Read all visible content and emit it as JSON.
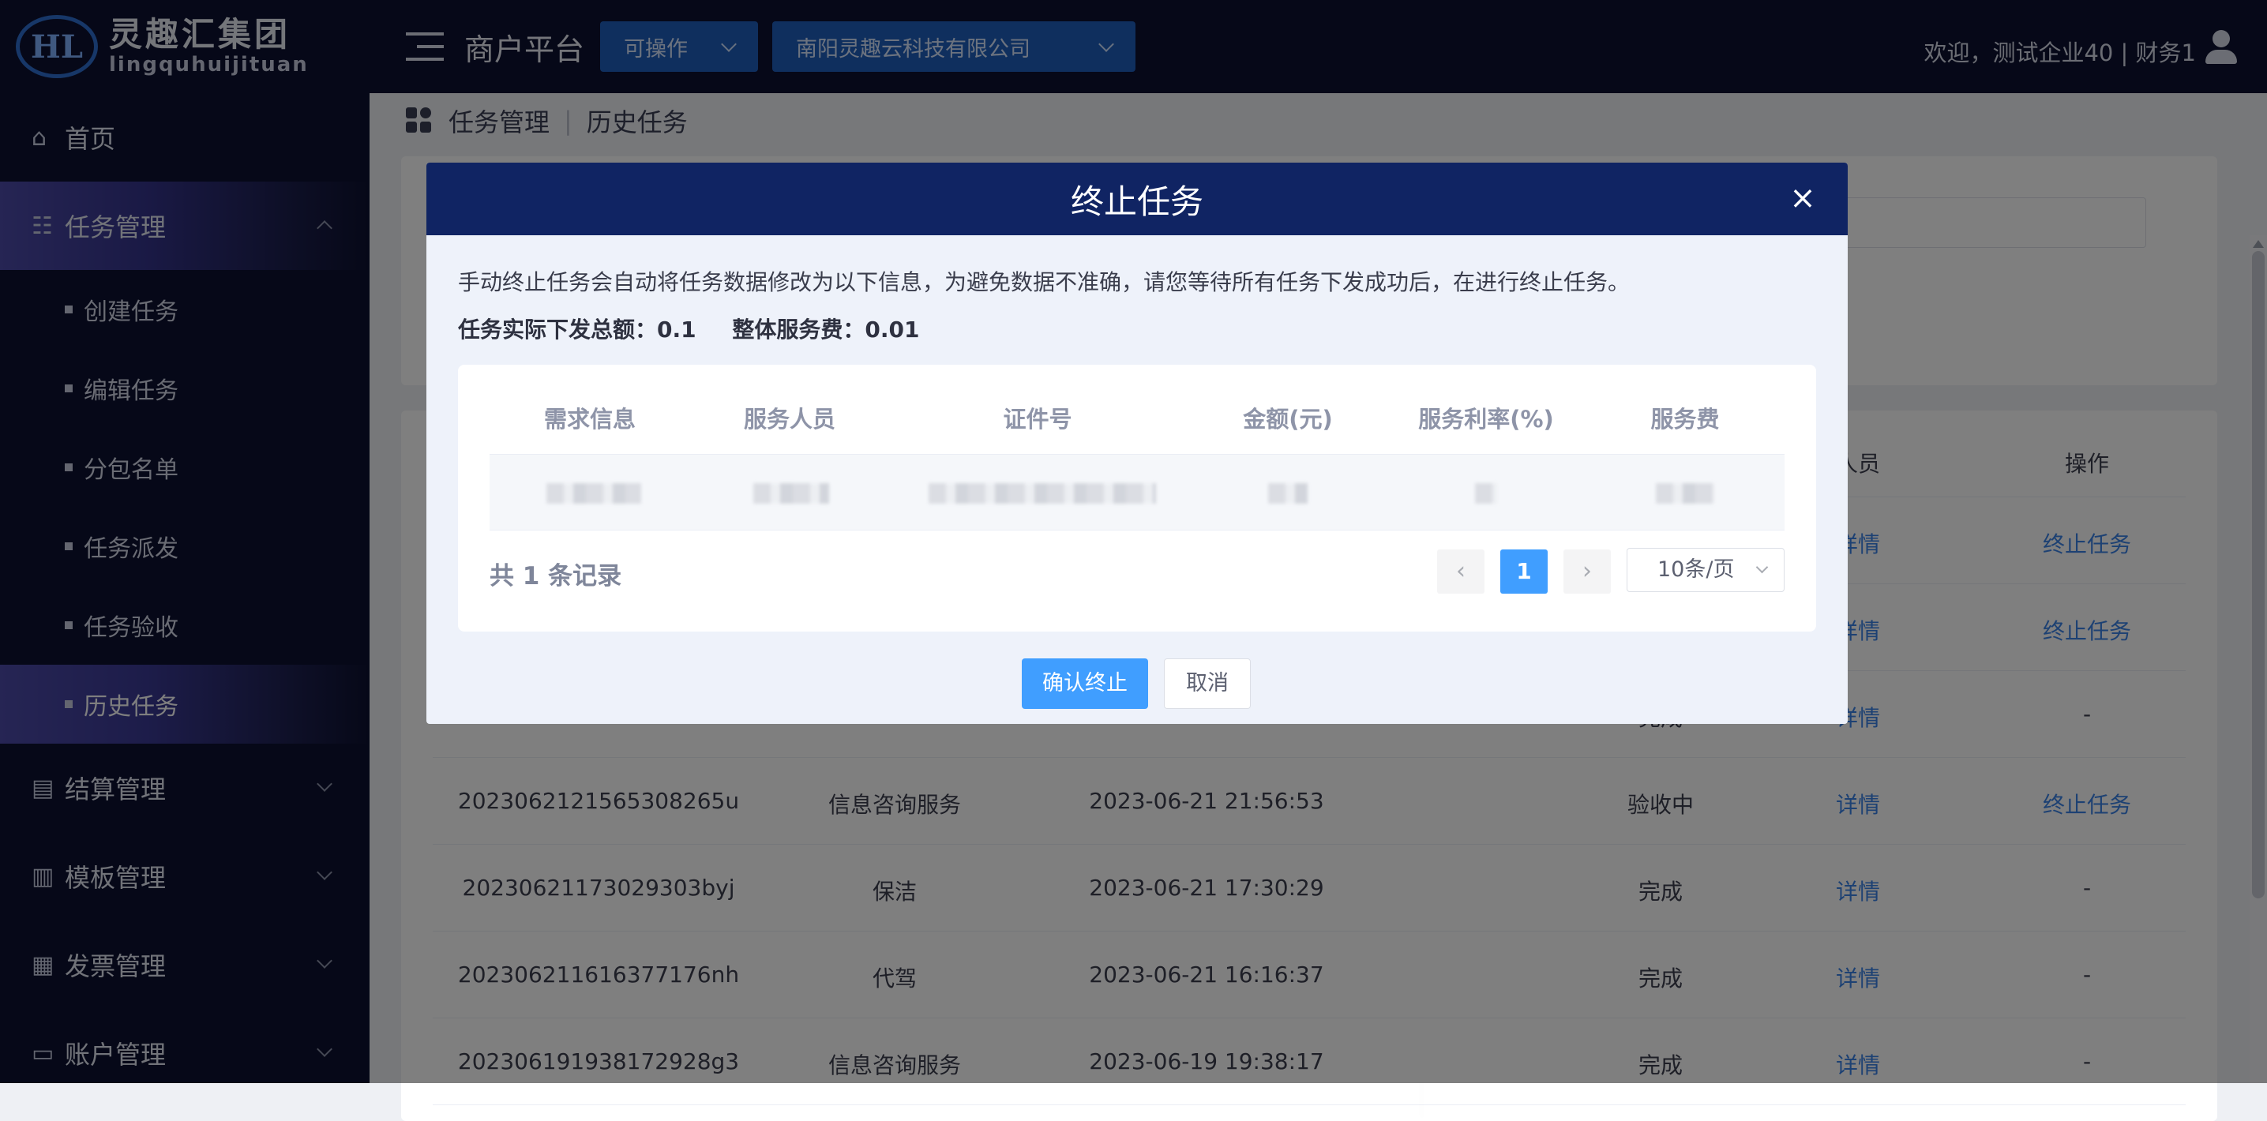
{
  "logo": {
    "mark": "HL",
    "cn": "灵趣汇集团",
    "en": "lingquhuijituan"
  },
  "sidebar": {
    "home": "首页",
    "task_mgmt": "任务管理",
    "sub_items": [
      "创建任务",
      "编辑任务",
      "分包名单",
      "任务派发",
      "任务验收",
      "历史任务"
    ],
    "settlement": "结算管理",
    "template": "模板管理",
    "invoice": "发票管理",
    "account": "账户管理"
  },
  "header": {
    "platform": "商户平台",
    "status_select": "可操作",
    "company_select": "南阳灵趣云科技有限公司",
    "welcome": "欢迎，测试企业40 | 财务1"
  },
  "breadcrumb": {
    "parent": "任务管理",
    "current": "历史任务"
  },
  "bg_table": {
    "header_col_a": "人员",
    "header_col_b": "操作",
    "rows": [
      {
        "id": "",
        "type": "",
        "time": "",
        "status": "",
        "detail": "详情",
        "action": "终止任务"
      },
      {
        "id": "",
        "type": "",
        "time": "",
        "status": "",
        "detail": "详情",
        "action": "终止任务"
      },
      {
        "id": "",
        "type": "",
        "time": "",
        "status": "完成",
        "detail": "详情",
        "action": "-"
      },
      {
        "id": "2023062121565308265u",
        "type": "信息咨询服务",
        "time": "2023-06-21 21:56:53",
        "status": "验收中",
        "detail": "详情",
        "action": "终止任务"
      },
      {
        "id": "20230621173029303byj",
        "type": "保洁",
        "time": "2023-06-21 17:30:29",
        "status": "完成",
        "detail": "详情",
        "action": "-"
      },
      {
        "id": "20230621161637​7176nh",
        "type": "代驾",
        "time": "2023-06-21 16:16:37",
        "status": "完成",
        "detail": "详情",
        "action": "-"
      },
      {
        "id": "20230619193817​2928g3",
        "type": "信息咨询服务",
        "time": "2023-06-19 19:38:17",
        "status": "完成",
        "detail": "详情",
        "action": "-"
      }
    ]
  },
  "modal": {
    "title": "终止任务",
    "close": "×",
    "notice": "手动终止任务会自动将任务数据修改为以下信息，为避免数据不准确，请您等待所有任务下发成功后，在进行终止任务。",
    "total_label": "任务实际下发总额：0.1",
    "fee_label": "整体服务费：0.01",
    "columns": [
      "需求信息",
      "服务人员",
      "证件号",
      "金额(元)",
      "服务利率(%)",
      "服务费"
    ],
    "record_count": "共 1 条记录",
    "prev": "‹",
    "next": "›",
    "current_page": "1",
    "page_size": "10条/页",
    "confirm": "确认终止",
    "cancel": "取消"
  }
}
